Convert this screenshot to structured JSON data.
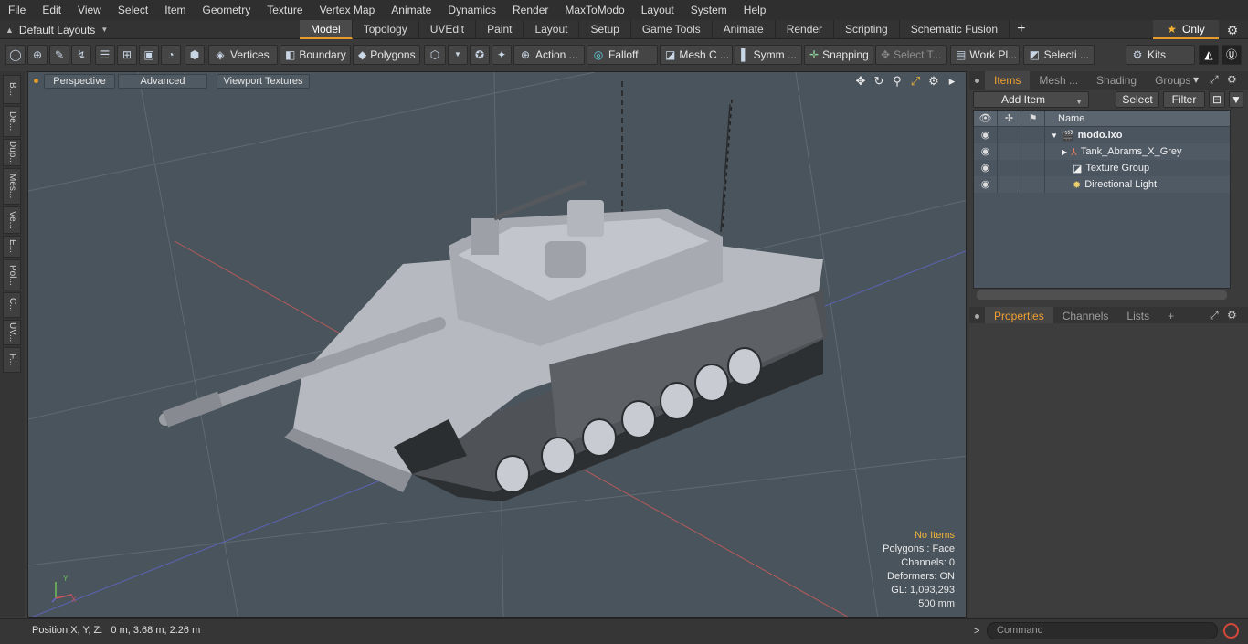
{
  "menu": [
    "File",
    "Edit",
    "View",
    "Select",
    "Item",
    "Geometry",
    "Texture",
    "Vertex Map",
    "Animate",
    "Dynamics",
    "Render",
    "MaxToModo",
    "Layout",
    "System",
    "Help"
  ],
  "layout_selector": "Default Layouts",
  "tabs": [
    "Model",
    "Topology",
    "UVEdit",
    "Paint",
    "Layout",
    "Setup",
    "Game Tools",
    "Animate",
    "Render",
    "Scripting",
    "Schematic Fusion"
  ],
  "active_tab": "Model",
  "only_label": "Only",
  "toolbar": {
    "vertices": "Vertices",
    "boundary": "Boundary",
    "polygons": "Polygons",
    "action": "Action ...",
    "falloff": "Falloff",
    "mesh": "Mesh C ...",
    "symm": "Symm ...",
    "snapping": "Snapping",
    "select_t": "Select T...",
    "work_pl": "Work Pl...",
    "selecti": "Selecti ...",
    "kits": "Kits"
  },
  "left_tabs": [
    "B...",
    "De...",
    "Dup...",
    "Mes...",
    "Ve...",
    "E...",
    "Pol...",
    "C...",
    "UV...",
    "F..."
  ],
  "viewport": {
    "perspective": "Perspective",
    "advanced": "Advanced",
    "textures": "Viewport Textures",
    "info": {
      "no_items": "No Items",
      "polygons": "Polygons : Face",
      "channels": "Channels: 0",
      "deformers": "Deformers: ON",
      "gl": "GL: 1,093,293",
      "scale": "500 mm"
    },
    "axis_labels": {
      "y": "Y",
      "x": "X"
    }
  },
  "status": {
    "position": "Position X, Y, Z:   0 m, 3.68 m, 2.26 m",
    "command_placeholder": "Command",
    "cmd_arrow": ">"
  },
  "items_panel": {
    "tabs": [
      "Items",
      "Mesh ...",
      "Shading",
      "Groups"
    ],
    "active_tab": "Items",
    "add_item": "Add Item",
    "select": "Select",
    "filter": "Filter",
    "name_header": "Name",
    "tree": [
      {
        "name": "modo.lxo",
        "bold": true,
        "icon": "scene-icon",
        "expanded": true
      },
      {
        "name": "Tank_Abrams_X_Grey",
        "icon": "mesh-locator-icon",
        "expanded": false
      },
      {
        "name": "Texture Group",
        "icon": "texture-group-icon"
      },
      {
        "name": "Directional Light",
        "icon": "light-icon"
      }
    ]
  },
  "props_panel": {
    "tabs": [
      "Properties",
      "Channels",
      "Lists"
    ],
    "active_tab": "Properties",
    "plus": "+"
  },
  "colors": {
    "accent": "#e79a2b",
    "info_highlight": "#f0b43a",
    "viewport_bg": "#4a545c",
    "tank": "#aeb2b8"
  }
}
